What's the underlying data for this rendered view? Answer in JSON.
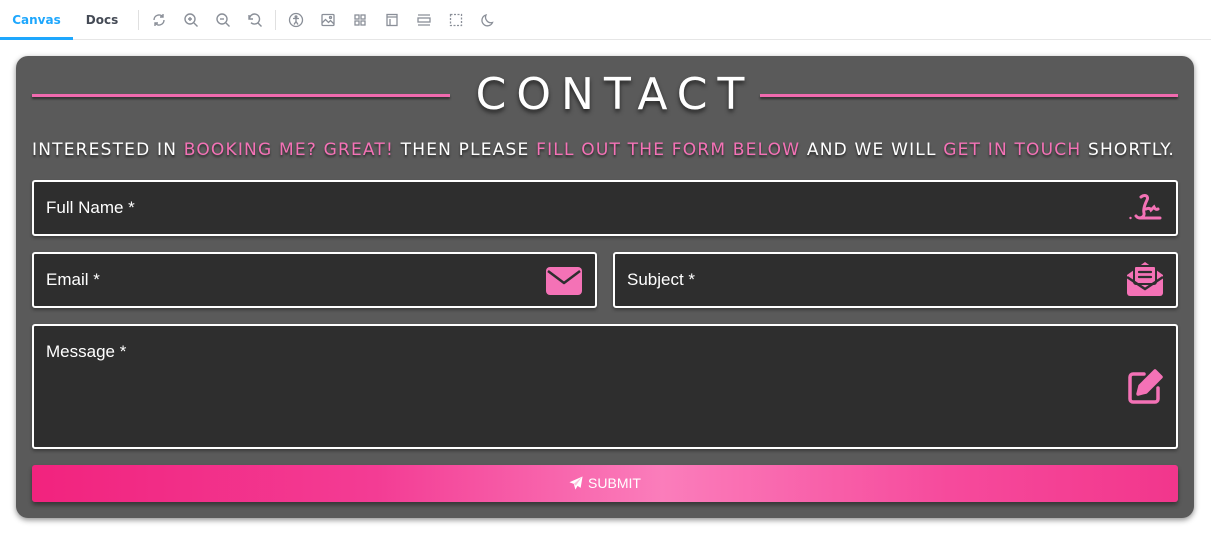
{
  "toolbar": {
    "tabs": [
      {
        "label": "Canvas",
        "active": true
      },
      {
        "label": "Docs",
        "active": false
      }
    ],
    "icons": [
      "reload-icon",
      "zoom-in-icon",
      "zoom-out-icon",
      "reset-zoom-icon",
      "accessibility-icon",
      "background-icon",
      "grid-icon",
      "viewport-icon",
      "measure-icon",
      "outline-icon",
      "dark-mode-icon"
    ]
  },
  "contact": {
    "title": "CONTACT",
    "intro": {
      "part1": "INTERESTED IN ",
      "highlight1": "BOOKING ME? GREAT!",
      "part2": " THEN PLEASE ",
      "highlight2": "FILL OUT THE FORM BELOW",
      "part3": " AND WE WILL ",
      "highlight3": "GET IN TOUCH",
      "part4": " SHORTLY."
    },
    "fields": {
      "full_name": {
        "label": "Full Name *",
        "icon": "signature-icon"
      },
      "email": {
        "label": "Email *",
        "icon": "envelope-icon"
      },
      "subject": {
        "label": "Subject *",
        "icon": "envelope-open-text-icon"
      },
      "message": {
        "label": "Message *",
        "icon": "edit-icon"
      }
    },
    "submit_label": "SUBMIT"
  },
  "colors": {
    "accent": "#f472b6",
    "card_bg": "#5a5a5a",
    "field_bg": "#2e2e2e",
    "tab_active": "#1ea7fd"
  }
}
